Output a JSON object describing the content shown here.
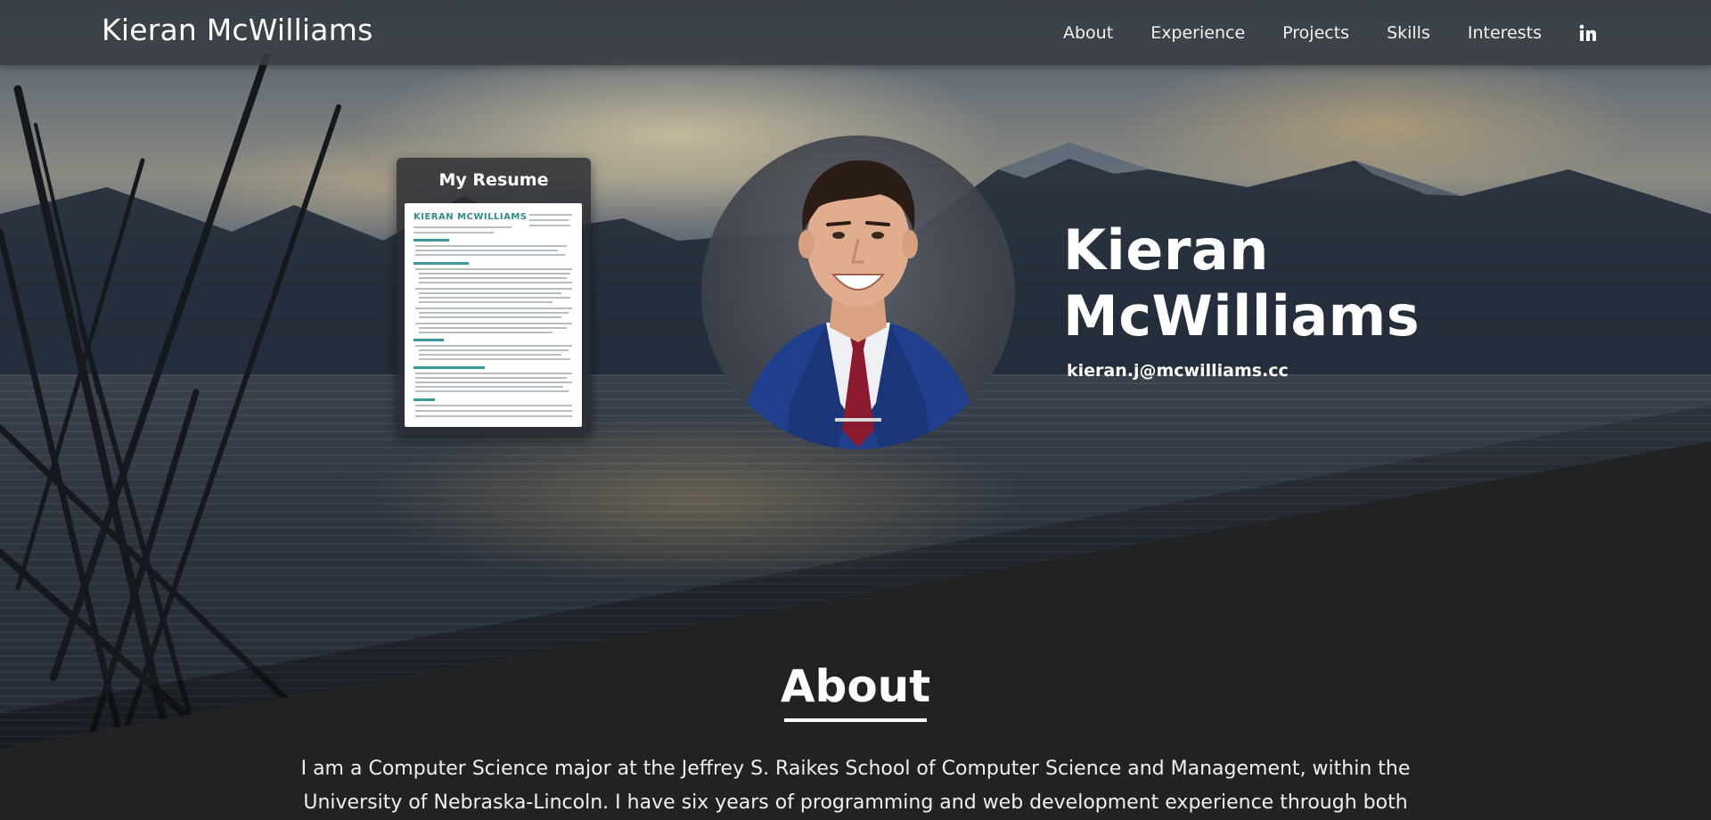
{
  "navbar": {
    "brand": "Kieran McWilliams",
    "links": [
      {
        "label": "About"
      },
      {
        "label": "Experience"
      },
      {
        "label": "Projects"
      },
      {
        "label": "Skills"
      },
      {
        "label": "Interests"
      }
    ],
    "social_icon": "linkedin-icon"
  },
  "resume": {
    "title": "My Resume",
    "thumbnail_name": "KIERAN MCWILLIAMS"
  },
  "hero": {
    "name_line1": "Kieran",
    "name_line2": "McWilliams",
    "email": "kieran.j@mcwilliams.cc",
    "portrait_icon": "portrait-photo"
  },
  "about": {
    "heading": "About",
    "text": "I am a Computer Science major at the Jeffrey S. Raikes School of Computer Science and Management, within the University of Nebraska-Lincoln. I have six years of programming and web development experience through both"
  },
  "colors": {
    "navbar_bg": "#373c42",
    "page_bg": "#212223",
    "resume_accent": "#2f8c8c",
    "tie": "#8b1a2e",
    "suit": "#1f3f8c"
  }
}
